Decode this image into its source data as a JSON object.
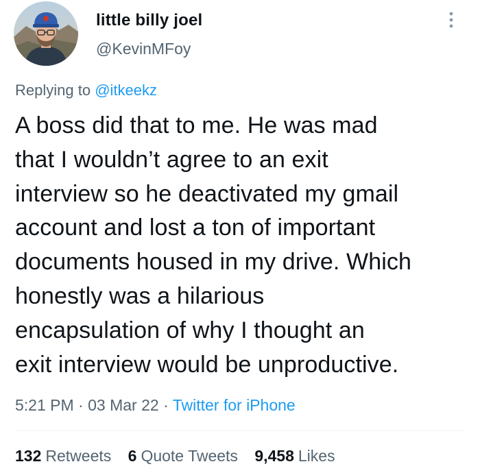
{
  "author": {
    "display_name": "little billy joel",
    "handle": "@KevinMFoy"
  },
  "reply": {
    "prefix": "Replying to",
    "mention": "@itkeekz"
  },
  "tweet": {
    "lines": [
      "A boss did that to me. He was mad",
      "that I wouldn’t agree to an exit",
      "interview so he deactivated my gmail",
      "account and lost a ton of important",
      "documents housed in my drive. Which",
      "honestly was a hilarious",
      "encapsulation of why I thought an",
      "exit interview would be unproductive."
    ],
    "time": "5:21 PM",
    "date": "03 Mar 22",
    "separator": "·",
    "source": "Twitter for iPhone"
  },
  "stats": {
    "retweets": {
      "count": "132",
      "label": "Retweets"
    },
    "quote_tweets": {
      "count": "6",
      "label": "Quote Tweets"
    },
    "likes": {
      "count": "9,458",
      "label": "Likes"
    }
  },
  "icons": {
    "more": "more-options-icon",
    "avatar": "profile-avatar"
  },
  "colors": {
    "text": "#0f1419",
    "secondary": "#536471",
    "link": "#1d9bf0",
    "divider": "#eff3f4"
  }
}
